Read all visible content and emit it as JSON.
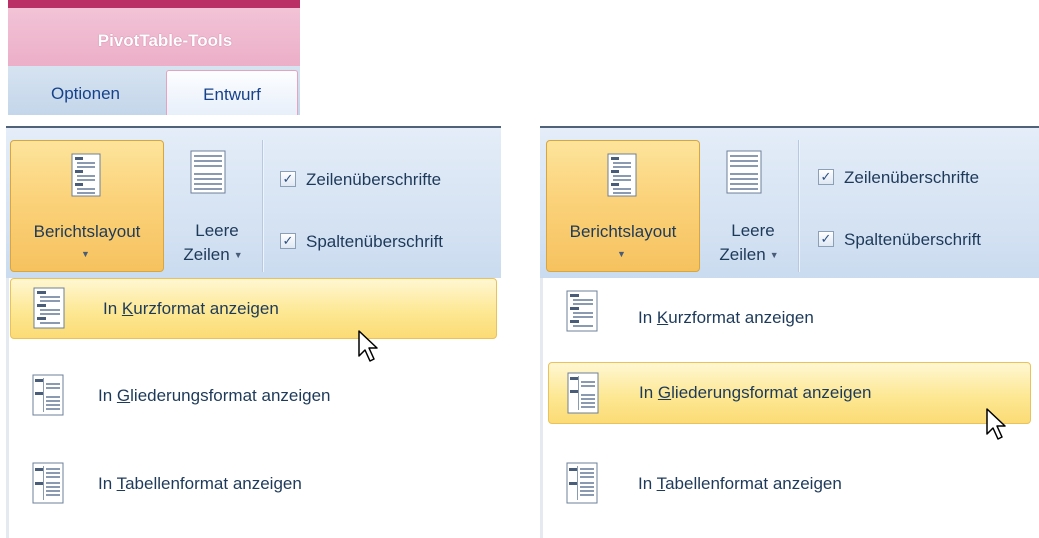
{
  "contextual_tab": {
    "title": "PivotTable-Tools",
    "tabs": [
      {
        "label": "Optionen",
        "selected": false
      },
      {
        "label": "Entwurf",
        "selected": true
      }
    ],
    "color": "#bb2f67"
  },
  "panels": [
    {
      "ribbon": {
        "berichtslayout_label": "Berichtslayout",
        "leere_zeilen_line1": "Leere",
        "leere_zeilen_line2": "Zeilen",
        "checkboxes": [
          {
            "label": "Zeilenüberschrifte",
            "checked": true
          },
          {
            "label": "Spaltenüberschrift",
            "checked": true
          }
        ]
      },
      "menu": {
        "highlighted_index": 0,
        "items": [
          {
            "pre": "In ",
            "accel": "K",
            "post": "urzformat anzeigen",
            "icon": "compact-layout-icon"
          },
          {
            "pre": "In ",
            "accel": "G",
            "post": "liederungsformat anzeigen",
            "icon": "outline-layout-icon"
          },
          {
            "pre": "In ",
            "accel": "T",
            "post": "abellenformat anzeigen",
            "icon": "tabular-layout-icon"
          }
        ]
      }
    },
    {
      "ribbon": {
        "berichtslayout_label": "Berichtslayout",
        "leere_zeilen_line1": "Leere",
        "leere_zeilen_line2": "Zeilen",
        "checkboxes": [
          {
            "label": "Zeilenüberschrifte",
            "checked": true
          },
          {
            "label": "Spaltenüberschrift",
            "checked": true
          }
        ]
      },
      "menu": {
        "highlighted_index": 1,
        "items": [
          {
            "pre": "In ",
            "accel": "K",
            "post": "urzformat anzeigen",
            "icon": "compact-layout-icon"
          },
          {
            "pre": "In ",
            "accel": "G",
            "post": "liederungsformat anzeigen",
            "icon": "outline-layout-icon"
          },
          {
            "pre": "In ",
            "accel": "T",
            "post": "abellenformat anzeigen",
            "icon": "tabular-layout-icon"
          }
        ]
      }
    }
  ],
  "colors": {
    "highlight": "#fbdb75",
    "ribbon": "#d3e1f2",
    "text": "#1e3a5a",
    "tab_text": "#15428b"
  }
}
